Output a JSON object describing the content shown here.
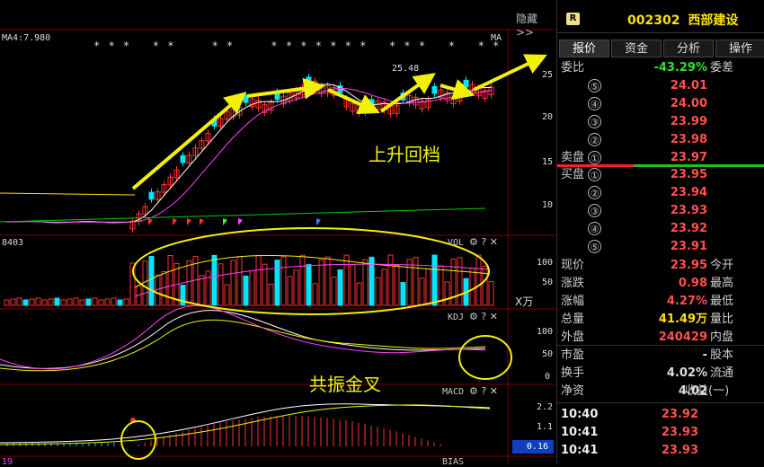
{
  "toolbar": {
    "hide_label": "隐藏>>"
  },
  "main_chart": {
    "ma_label": "MA4:7.980",
    "ma_tag": "MA",
    "stars_text": "* * *   * *     * *     * * * * * * *   * * *   *   * *",
    "axis_ticks": [
      "25",
      "20",
      "15",
      "10"
    ],
    "peak_label": "25.48",
    "annotation": "上升回档"
  },
  "volume_panel": {
    "left_value": "8403",
    "title": "VOL",
    "axis_ticks": [
      "100",
      "50"
    ],
    "unit": "X万"
  },
  "kdj_panel": {
    "title": "KDJ",
    "axis_ticks": [
      "100",
      "50",
      "0"
    ],
    "annotation": "共振金叉"
  },
  "macd_panel": {
    "title": "MACD",
    "axis_ticks": [
      "2.2",
      "1.1"
    ],
    "current_value": "0.16"
  },
  "bias_panel": {
    "title": "BIAS",
    "left_value": "19"
  },
  "panel": {
    "badge": "R",
    "code": "002302",
    "name": "西部建设",
    "tabs": [
      "报价",
      "资金",
      "分析",
      "操作"
    ],
    "weibi_label": "委比",
    "weibi_value": "-43.29%",
    "weicha_label": "委差",
    "sell_orders": [
      {
        "label": "",
        "num": "⑤",
        "price": "24.01"
      },
      {
        "label": "",
        "num": "④",
        "price": "24.00"
      },
      {
        "label": "",
        "num": "③",
        "price": "23.99"
      },
      {
        "label": "",
        "num": "②",
        "price": "23.98"
      },
      {
        "label": "卖盘",
        "num": "①",
        "price": "23.97"
      }
    ],
    "buy_orders": [
      {
        "label": "买盘",
        "num": "①",
        "price": "23.95"
      },
      {
        "label": "",
        "num": "②",
        "price": "23.94"
      },
      {
        "label": "",
        "num": "③",
        "price": "23.93"
      },
      {
        "label": "",
        "num": "④",
        "price": "23.92"
      },
      {
        "label": "",
        "num": "⑤",
        "price": "23.91"
      }
    ],
    "stats": [
      {
        "l1": "现价",
        "v1": "23.95",
        "l2": "今开"
      },
      {
        "l1": "涨跌",
        "v1": "0.98",
        "l2": "最高"
      },
      {
        "l1": "涨幅",
        "v1": "4.27%",
        "l2": "最低"
      },
      {
        "l1": "总量",
        "v1": "41.49万",
        "l2": "量比"
      },
      {
        "l1": "外盘",
        "v1": "240429",
        "l2": "内盘"
      }
    ],
    "stats2": [
      {
        "l1": "市盈",
        "v1": "-",
        "l2": "股本"
      },
      {
        "l1": "换手",
        "v1": "4.02%",
        "l2": "流通"
      },
      {
        "l1": "净资",
        "v1": "4.02",
        "l2": "收益(一)"
      }
    ],
    "ticks": [
      {
        "time": "10:40",
        "price": "23.92"
      },
      {
        "time": "10:41",
        "price": "23.93"
      },
      {
        "time": "10:41",
        "price": "23.93"
      }
    ]
  },
  "colors": {
    "up": "#ff3030",
    "down": "#00e5ff",
    "accent_yellow": "#ffe000",
    "ma_white": "#ffffff",
    "ma_magenta": "#ff40ff",
    "ma_green": "#00d000"
  }
}
